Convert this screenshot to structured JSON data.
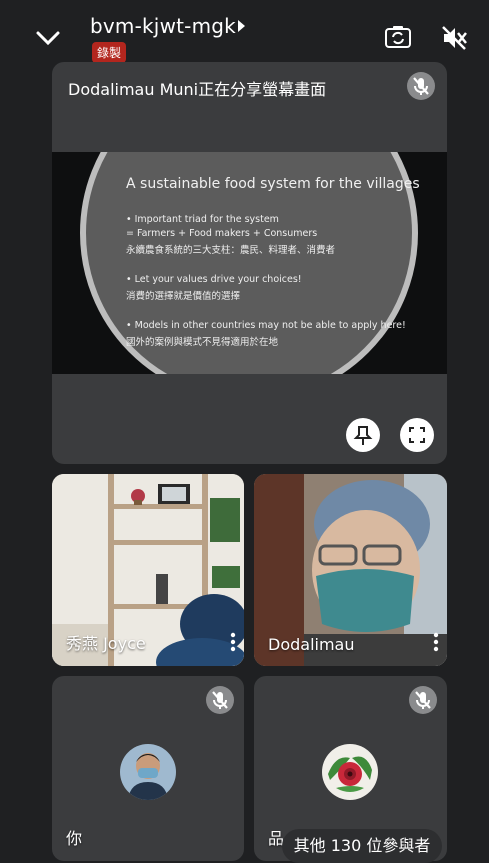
{
  "header": {
    "meeting_code": "bvm-kjwt-mgk",
    "recording_badge": "錄製"
  },
  "presenter": {
    "title": "Dodalimau Muni正在分享螢幕畫面",
    "slide": {
      "title": "A sustainable food system for the villages",
      "lines": [
        "• Important triad for the system",
        "= Farmers + Food makers + Consumers",
        "永續農食系統的三大支柱：農民、料理者、消費者",
        "• Let your values drive your choices!",
        "消費的選擇就是價值的選擇",
        "• Models in other countries may not be able to apply here!",
        "國外的案例與模式不見得適用於在地"
      ]
    }
  },
  "tiles": [
    {
      "name": "秀燕 Joyce"
    },
    {
      "name": "Dodalimau"
    },
    {
      "name": "你"
    },
    {
      "name": "品"
    }
  ],
  "others_label": "其他 130 位參與者",
  "colors": {
    "background": "#1f2022",
    "tile": "#3b3c3e",
    "recording": "#b3261e"
  }
}
